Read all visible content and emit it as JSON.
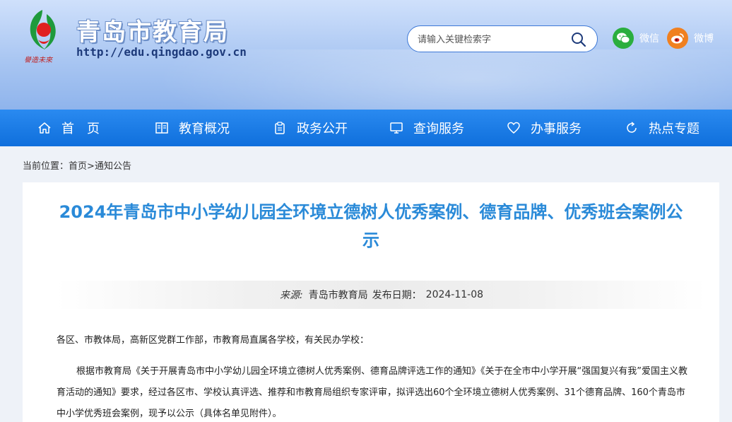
{
  "header": {
    "site_title": "青岛市教育局",
    "site_url": "http://edu.qingdao.gov.cn",
    "logo_caption": "譽造未來",
    "search": {
      "placeholder": "请输入关键检索字"
    },
    "social": [
      {
        "label": "微信",
        "icon": "wechat-icon",
        "color": "#2aae3e"
      },
      {
        "label": "微博",
        "icon": "weibo-icon",
        "color": "#f08020"
      }
    ]
  },
  "nav": {
    "items": [
      {
        "label": "首　页",
        "icon": "home-icon"
      },
      {
        "label": "教育概况",
        "icon": "book-icon"
      },
      {
        "label": "政务公开",
        "icon": "clipboard-icon"
      },
      {
        "label": "查询服务",
        "icon": "monitor-icon"
      },
      {
        "label": "办事服务",
        "icon": "heart-icon"
      },
      {
        "label": "热点专题",
        "icon": "refresh-icon"
      }
    ]
  },
  "breadcrumb": {
    "prefix": "当前位置：",
    "home": "首页",
    "sep": ">",
    "current": "通知公告"
  },
  "article": {
    "title": "2024年青岛市中小学幼儿园全环境立德树人优秀案例、德育品牌、优秀班会案例公示",
    "source_label": "来源:",
    "source": "青岛市教育局",
    "date_label": "发布日期：",
    "date": "2024-11-08",
    "salutation": "各区、市教体局，高新区党群工作部，市教育局直属各学校，有关民办学校：",
    "paragraph": "根据市教育局《关于开展青岛市中小学幼儿园全环境立德树人优秀案例、德育品牌评选工作的通知》《关于在全市中小学开展“强国复兴有我”爱国主义教育活动的通知》要求，经过各区市、学校认真评选、推荐和市教育局组织专家评审，拟评选出60个全环境立德树人优秀案例、31个德育品牌、160个青岛市中小学优秀班会案例，现予以公示（具体名单见附件）。"
  },
  "colors": {
    "nav_bg": "#1a7ee6",
    "title_blue": "#2a8ad8",
    "header_bg": "#a9c6f2"
  }
}
